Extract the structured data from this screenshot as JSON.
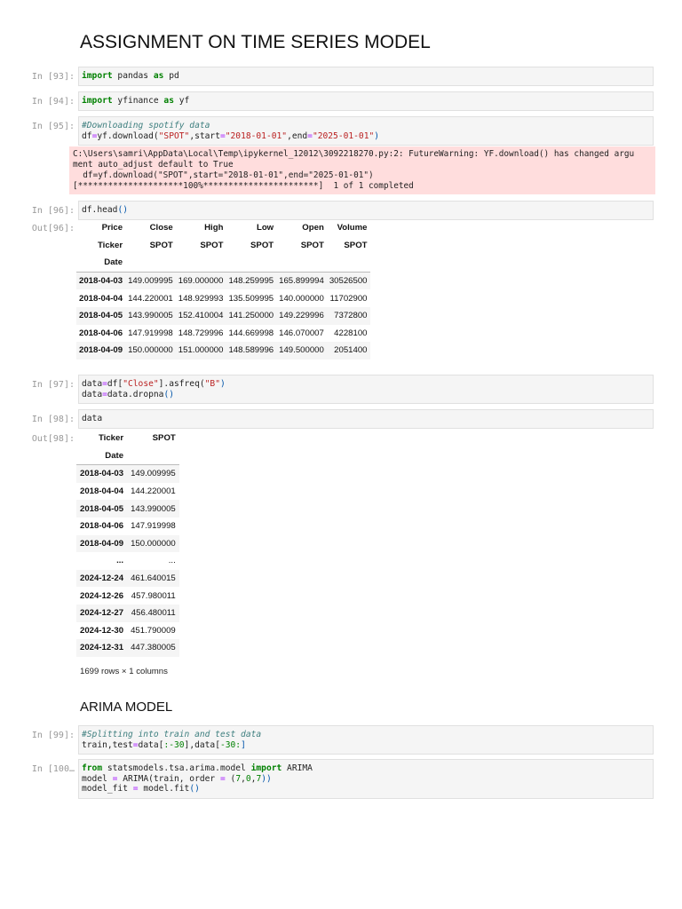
{
  "title": "ASSIGNMENT ON TIME SERIES MODEL",
  "section_heading": "ARIMA MODEL",
  "cells": [
    {
      "prompt": "In [93]:",
      "lines": [
        [
          [
            "import",
            "kw"
          ],
          [
            " pandas ",
            ""
          ],
          [
            "as",
            "kw"
          ],
          [
            " pd",
            ""
          ]
        ]
      ]
    },
    {
      "prompt": "In [94]:",
      "lines": [
        [
          [
            "import",
            "kw"
          ],
          [
            " yfinance ",
            ""
          ],
          [
            "as",
            "kw"
          ],
          [
            " yf",
            ""
          ]
        ]
      ]
    },
    {
      "prompt": "In [95]:",
      "lines": [
        [
          [
            "#Downloading spotify data",
            "cm"
          ]
        ],
        [
          [
            "df",
            ""
          ],
          [
            "=",
            "op"
          ],
          [
            "yf.download(",
            ""
          ],
          [
            "\"SPOT\"",
            "str"
          ],
          [
            ",start",
            ""
          ],
          [
            "=",
            "op"
          ],
          [
            "\"2018-01-01\"",
            "str"
          ],
          [
            ",end",
            ""
          ],
          [
            "=",
            "op"
          ],
          [
            "\"2025-01-01\"",
            "str"
          ],
          [
            ")",
            "br"
          ]
        ]
      ]
    },
    {
      "prompt": "In [96]:",
      "lines": [
        [
          [
            "df.head",
            ""
          ],
          [
            "()",
            "br"
          ]
        ]
      ]
    },
    {
      "prompt": "In [97]:",
      "lines": [
        [
          [
            "data",
            ""
          ],
          [
            "=",
            "op"
          ],
          [
            "df[",
            ""
          ],
          [
            "\"Close\"",
            "str"
          ],
          [
            "].asfreq(",
            ""
          ],
          [
            "\"B\"",
            "str"
          ],
          [
            ")",
            "br"
          ]
        ],
        [
          [
            "data",
            ""
          ],
          [
            "=",
            "op"
          ],
          [
            "data.dropna",
            ""
          ],
          [
            "()",
            "br"
          ]
        ]
      ]
    },
    {
      "prompt": "In [98]:",
      "lines": [
        [
          [
            "data",
            ""
          ]
        ]
      ]
    },
    {
      "prompt": "In [99]:",
      "lines": [
        [
          [
            "#Splitting into train and test data",
            "cm"
          ]
        ],
        [
          [
            "train,test",
            ""
          ],
          [
            "=",
            "op"
          ],
          [
            "data[",
            ""
          ],
          [
            ":-30",
            "num"
          ],
          [
            "],data[",
            ""
          ],
          [
            "-30:",
            "num"
          ],
          [
            "]",
            "br"
          ]
        ]
      ]
    },
    {
      "prompt": "In [100…",
      "lines": [
        [
          [
            "from",
            "kw"
          ],
          [
            " statsmodels.tsa.arima.model ",
            ""
          ],
          [
            "import",
            "kw"
          ],
          [
            " ARIMA",
            ""
          ]
        ],
        [
          [
            "model ",
            ""
          ],
          [
            "=",
            "op"
          ],
          [
            " ARIMA(train, order ",
            ""
          ],
          [
            "=",
            "op"
          ],
          [
            " (",
            ""
          ],
          [
            "7",
            "num"
          ],
          [
            ",",
            ""
          ],
          [
            "0",
            "num"
          ],
          [
            ",",
            ""
          ],
          [
            "7",
            "num"
          ],
          [
            "))",
            "br"
          ]
        ],
        [
          [
            "model_fit ",
            ""
          ],
          [
            "=",
            "op"
          ],
          [
            " model.fit",
            ""
          ],
          [
            "()",
            "br"
          ]
        ]
      ]
    }
  ],
  "stderr": [
    "C:\\Users\\samri\\AppData\\Local\\Temp\\ipykernel_12012\\3092218270.py:2: FutureWarning: YF.download() has changed argu",
    "ment auto_adjust default to True",
    "  df=yf.download(\"SPOT\",start=\"2018-01-01\",end=\"2025-01-01\")",
    "[*********************100%***********************]  1 of 1 completed"
  ],
  "out96": {
    "prompt": "Out[96]:",
    "header1": [
      "Price",
      "Close",
      "High",
      "Low",
      "Open",
      "Volume"
    ],
    "header2": [
      "Ticker",
      "SPOT",
      "SPOT",
      "SPOT",
      "SPOT",
      "SPOT"
    ],
    "header3": [
      "Date",
      "",
      "",
      "",
      "",
      ""
    ],
    "rows": [
      [
        "2018-04-03",
        "149.009995",
        "169.000000",
        "148.259995",
        "165.899994",
        "30526500"
      ],
      [
        "2018-04-04",
        "144.220001",
        "148.929993",
        "135.509995",
        "140.000000",
        "11702900"
      ],
      [
        "2018-04-05",
        "143.990005",
        "152.410004",
        "141.250000",
        "149.229996",
        "7372800"
      ],
      [
        "2018-04-06",
        "147.919998",
        "148.729996",
        "144.669998",
        "146.070007",
        "4228100"
      ],
      [
        "2018-04-09",
        "150.000000",
        "151.000000",
        "148.589996",
        "149.500000",
        "2051400"
      ]
    ]
  },
  "out98": {
    "prompt": "Out[98]:",
    "header1": [
      "Ticker",
      "SPOT"
    ],
    "header2": [
      "Date",
      ""
    ],
    "rows": [
      [
        "2018-04-03",
        "149.009995"
      ],
      [
        "2018-04-04",
        "144.220001"
      ],
      [
        "2018-04-05",
        "143.990005"
      ],
      [
        "2018-04-06",
        "147.919998"
      ],
      [
        "2018-04-09",
        "150.000000"
      ],
      [
        "...",
        "..."
      ],
      [
        "2024-12-24",
        "461.640015"
      ],
      [
        "2024-12-26",
        "457.980011"
      ],
      [
        "2024-12-27",
        "456.480011"
      ],
      [
        "2024-12-30",
        "451.790009"
      ],
      [
        "2024-12-31",
        "447.380005"
      ]
    ],
    "footer": "1699 rows × 1 columns"
  }
}
